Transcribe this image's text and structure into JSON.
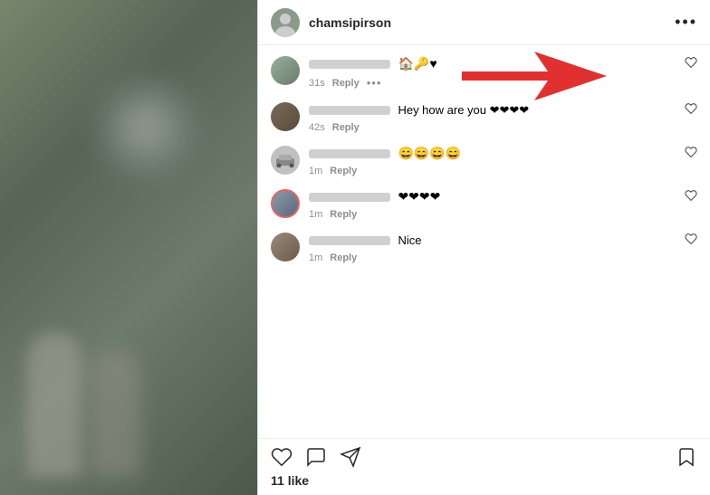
{
  "header": {
    "username": "chamsipirson",
    "more_icon": "•••"
  },
  "comments": [
    {
      "id": "c1",
      "time": "31s",
      "reply_label": "Reply",
      "more": "•••",
      "text_emojis": "🏠🔑♥",
      "avatar_class": "person1",
      "has_arrow": true
    },
    {
      "id": "c2",
      "time": "42s",
      "reply_label": "Reply",
      "text": "Hey how are you ❤❤❤❤",
      "avatar_class": "person2"
    },
    {
      "id": "c3",
      "time": "1m",
      "reply_label": "Reply",
      "text": "😄😄😄😄",
      "avatar_class": "car_avatar"
    },
    {
      "id": "c4",
      "time": "1m",
      "reply_label": "Reply",
      "text": "❤❤❤❤",
      "avatar_class": "person3"
    },
    {
      "id": "c5",
      "time": "1m",
      "reply_label": "Reply",
      "text": "Nice",
      "avatar_class": "person4"
    }
  ],
  "actions": {
    "like_icon": "heart",
    "comment_icon": "comment",
    "share_icon": "send",
    "bookmark_icon": "bookmark"
  },
  "likes_count": "11 like"
}
